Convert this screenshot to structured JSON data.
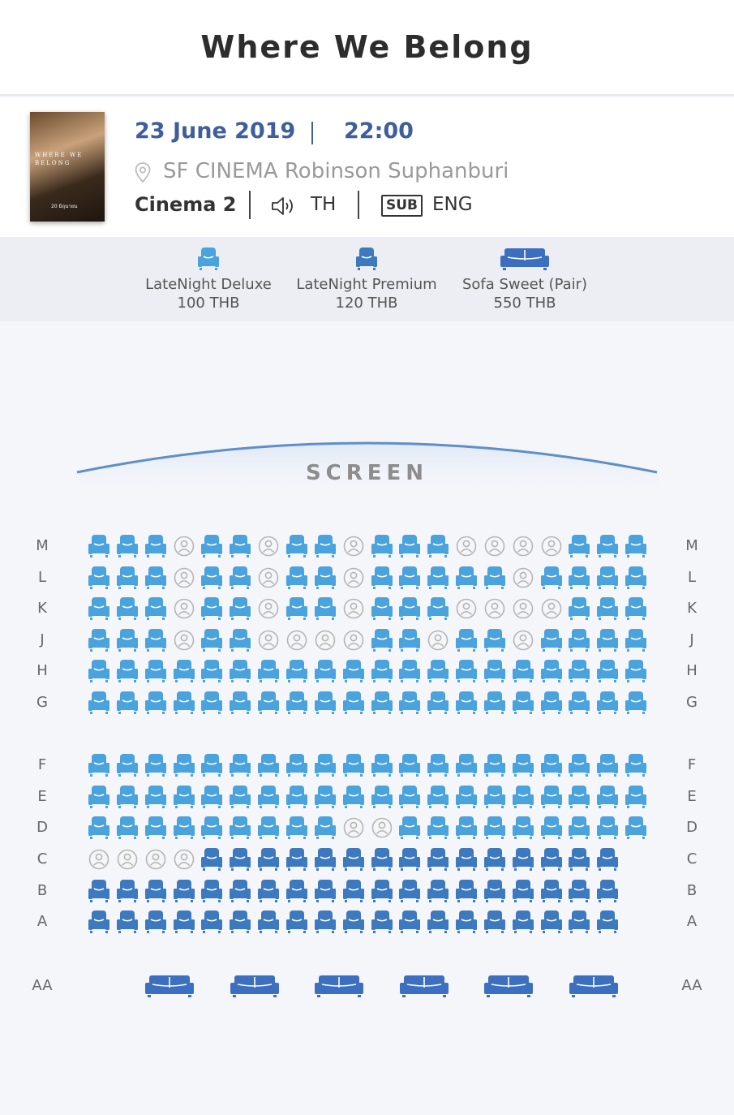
{
  "header": {
    "title": "Where We Belong"
  },
  "showtime": {
    "date": "23 June 2019",
    "time": "22:00",
    "venue": "SF CINEMA Robinson Suphanburi",
    "cinema": "Cinema 2",
    "audio": "TH",
    "subtitle_badge": "SUB",
    "subtitle": "ENG",
    "poster_title": "WHERE WE BELONG",
    "poster_date": "20 มิถุนายน"
  },
  "legend": [
    {
      "name": "LateNight Deluxe",
      "price": "100 THB",
      "type": "deluxe"
    },
    {
      "name": "LateNight Premium",
      "price": "120 THB",
      "type": "premium"
    },
    {
      "name": "Sofa Sweet (Pair)",
      "price": "550 THB",
      "type": "sofa"
    }
  ],
  "screen": {
    "label": "SCREEN"
  },
  "colors": {
    "deluxe": "#4aa3dd",
    "premium": "#3d79bf",
    "sofa": "#3d6fc0",
    "taken": "#b5b5b5",
    "title_blue": "#3f5e9c"
  },
  "seat_rows": [
    {
      "label": "M",
      "type": "deluxe",
      "seats": 20,
      "taken": [
        4,
        7,
        10,
        14,
        15,
        16,
        17
      ]
    },
    {
      "label": "L",
      "type": "deluxe",
      "seats": 20,
      "taken": [
        4,
        7,
        10,
        16
      ]
    },
    {
      "label": "K",
      "type": "deluxe",
      "seats": 20,
      "taken": [
        4,
        7,
        10,
        14,
        15,
        16,
        17
      ]
    },
    {
      "label": "J",
      "type": "deluxe",
      "seats": 20,
      "taken": [
        4,
        7,
        8,
        9,
        10,
        13,
        16
      ]
    },
    {
      "label": "H",
      "type": "deluxe",
      "seats": 20,
      "taken": []
    },
    {
      "label": "G",
      "type": "deluxe",
      "seats": 20,
      "taken": []
    },
    {
      "label": "F",
      "type": "deluxe",
      "seats": 20,
      "taken": []
    },
    {
      "label": "E",
      "type": "deluxe",
      "seats": 20,
      "taken": []
    },
    {
      "label": "D",
      "type": "deluxe",
      "seats": 20,
      "taken": [
        10,
        11
      ]
    },
    {
      "label": "C",
      "type": "premium",
      "seats": 19,
      "taken": [
        1,
        2,
        3,
        4
      ]
    },
    {
      "label": "B",
      "type": "premium",
      "seats": 19,
      "taken": []
    },
    {
      "label": "A",
      "type": "premium",
      "seats": 19,
      "taken": []
    }
  ],
  "sofa_row": {
    "label": "AA",
    "type": "sofa",
    "seats": 6
  }
}
